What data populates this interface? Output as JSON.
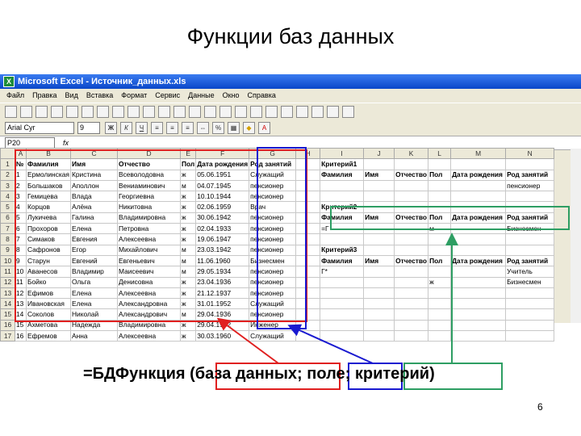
{
  "slide": {
    "title": "Функции баз данных",
    "formula": "=БДФункция (база данных; поле; критерий)",
    "page_number": "6"
  },
  "window": {
    "title": "Microsoft Excel - Источник_данных.xls",
    "menu": [
      "Файл",
      "Правка",
      "Вид",
      "Вставка",
      "Формат",
      "Сервис",
      "Данные",
      "Окно",
      "Справка"
    ],
    "font_name": "Arial Cyr",
    "font_size": "9",
    "name_box": "P20",
    "fx": "fx"
  },
  "sheet": {
    "columns": [
      "A",
      "B",
      "C",
      "D",
      "E",
      "F",
      "G",
      "H",
      "I",
      "J",
      "K",
      "L",
      "M",
      "N"
    ],
    "header_row": [
      "№",
      "Фамилия",
      "Имя",
      "Отчество",
      "Пол",
      "Дата рождения",
      "Род занятий",
      "",
      "Критерий1",
      "",
      "",
      "",
      "",
      ""
    ],
    "rows": [
      [
        "1",
        "Ермолинская",
        "Кристина",
        "Всеволодовна",
        "ж",
        "05.06.1951",
        "Служащий",
        "",
        "Фамилия",
        "Имя",
        "Отчество",
        "Пол",
        "Дата рождения",
        "Род занятий"
      ],
      [
        "2",
        "Большаков",
        "Аполлон",
        "Вениаминович",
        "м",
        "04.07.1945",
        "пенсионер",
        "",
        "",
        "",
        "",
        "",
        "",
        "пенсионер"
      ],
      [
        "3",
        "Гемицева",
        "Влада",
        "Георгиевна",
        "ж",
        "10.10.1944",
        "пенсионер",
        "",
        "",
        "",
        "",
        "",
        "",
        ""
      ],
      [
        "4",
        "Корцов",
        "Алёна",
        "Никитовна",
        "ж",
        "02.06.1959",
        "Врач",
        "",
        "Критерий2",
        "",
        "",
        "",
        "",
        ""
      ],
      [
        "5",
        "Лукичева",
        "Галина",
        "Владимировна",
        "ж",
        "30.06.1942",
        "пенсионер",
        "",
        "Фамилия",
        "Имя",
        "Отчество",
        "Пол",
        "Дата рождения",
        "Род занятий"
      ],
      [
        "6",
        "Прохоров",
        "Елена",
        "Петровна",
        "ж",
        "02.04.1933",
        "пенсионер",
        "",
        "=Г",
        "",
        "",
        "м",
        "",
        "Бизнесмен"
      ],
      [
        "7",
        "Симаков",
        "Евгения",
        "Алексеевна",
        "ж",
        "19.06.1947",
        "пенсионер",
        "",
        "",
        "",
        "",
        "",
        "",
        ""
      ],
      [
        "8",
        "Сафронов",
        "Егор",
        "Михайлович",
        "м",
        "23.03.1942",
        "пенсионер",
        "",
        "Критерий3",
        "",
        "",
        "",
        "",
        ""
      ],
      [
        "9",
        "Старун",
        "Евгений",
        "Евгеньевич",
        "м",
        "11.06.1960",
        "Бизнесмен",
        "",
        "Фамилия",
        "Имя",
        "Отчество",
        "Пол",
        "Дата рождения",
        "Род занятий"
      ],
      [
        "10",
        "Аванесов",
        "Владимир",
        "Маисеевич",
        "м",
        "29.05.1934",
        "пенсионер",
        "",
        "Г*",
        "",
        "",
        "",
        "",
        "Учитель"
      ],
      [
        "11",
        "Бойко",
        "Ольга",
        "Денисовна",
        "ж",
        "23.04.1936",
        "пенсионер",
        "",
        "",
        "",
        "",
        "ж",
        "",
        "Бизнесмен"
      ],
      [
        "12",
        "Ефимов",
        "Елена",
        "Алексеевна",
        "ж",
        "21.12.1937",
        "пенсионер",
        "",
        "",
        "",
        "",
        "",
        "",
        ""
      ],
      [
        "13",
        "Ивановская",
        "Елена",
        "Александровна",
        "ж",
        "31.01.1952",
        "Служащий",
        "",
        "",
        "",
        "",
        "",
        "",
        ""
      ],
      [
        "14",
        "Соколов",
        "Николай",
        "Александрович",
        "м",
        "29.04.1936",
        "пенсионер",
        "",
        "",
        "",
        "",
        "",
        "",
        ""
      ],
      [
        "15",
        "Ахметова",
        "Надежда",
        "Владимировна",
        "ж",
        "29.04.1952",
        "Инженер",
        "",
        "",
        "",
        "",
        "",
        "",
        ""
      ],
      [
        "16",
        "Ефремов",
        "Анна",
        "Алексеевна",
        "ж",
        "30.03.1960",
        "Служащий",
        "",
        "",
        "",
        "",
        "",
        "",
        ""
      ]
    ]
  },
  "colors": {
    "red_box": "#e02020",
    "blue_box": "#1a1ad0",
    "green_box": "#2e9e63"
  }
}
